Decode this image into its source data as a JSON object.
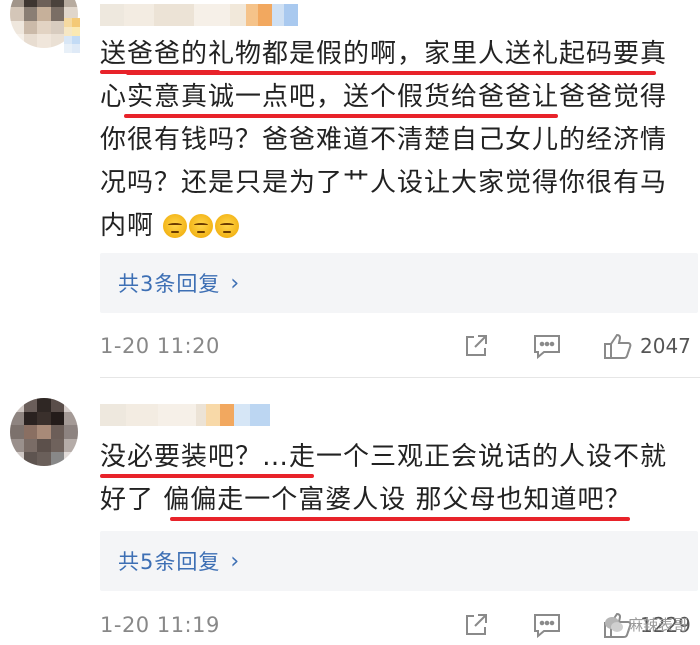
{
  "comments": [
    {
      "text_lines": [
        "送爸爸的礼物都是假的啊，家里人送礼起码要真",
        "心实意真诚一点吧，送个假货给爸爸让爸爸觉得",
        "你很有钱吗？爸爸难道不清楚自己女儿的经济情",
        "况吗？还是只是为了艹人设让大家觉得你很有马",
        "内啊"
      ],
      "emojis": [
        "smirk-emoji",
        "smirk-emoji",
        "smirk-emoji"
      ],
      "reply_label": "共3条回复",
      "time": "1-20 11:20",
      "like_count": "2047"
    },
    {
      "text_lines": [
        "没必要装吧？…走一个三观正会说话的人设不就",
        "好了  偏偏走一个富婆人设 那父母也知道吧？"
      ],
      "reply_label": "共5条回复",
      "time": "1-20 11:19",
      "like_count": "1229"
    }
  ],
  "watermark": {
    "text": "麻辣表哥",
    "icon": "wechat-icon"
  },
  "colors": {
    "underline": "#e8232a",
    "link": "#3d6fb4",
    "reply_bg": "#f4f5f7"
  }
}
